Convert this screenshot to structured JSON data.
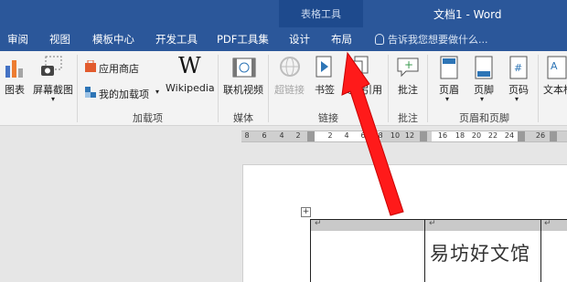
{
  "window": {
    "context_group": "表格工具",
    "doc_title": "文档1 - Word"
  },
  "tabs": [
    "审阅",
    "视图",
    "模板中心",
    "开发工具",
    "PDF工具集",
    "设计",
    "布局"
  ],
  "tell_me": "告诉我您想要做什么...",
  "ribbon": {
    "chart": "图表",
    "screenshot": "屏幕截图",
    "app_store": "应用商店",
    "my_addins": "我的加载项",
    "wikipedia_logo": "W",
    "wikipedia": "Wikipedia",
    "online_video": "联机视频",
    "link": "超链接",
    "bookmark": "书签",
    "cross_ref": "交叉引用",
    "comment": "批注",
    "header": "页眉",
    "footer": "页脚",
    "page_number": "页码",
    "textbox": "文本框",
    "groups": {
      "addins": "加载项",
      "media": "媒体",
      "links": "链接",
      "comments": "批注",
      "header_footer": "页眉和页脚"
    }
  },
  "ruler": {
    "left_ticks": [
      "8",
      "6",
      "4",
      "2"
    ],
    "mid_ticks": [
      "2",
      "4",
      "6",
      "8"
    ],
    "right_ticks": [
      "10",
      "12",
      "16",
      "18",
      "20",
      "22",
      "24",
      "26"
    ]
  },
  "table": {
    "handle": "+",
    "cell_mark": "↵"
  },
  "watermark": "易坊好文馆",
  "colors": {
    "title_bar": "#2b579a",
    "contextual_tab": "#1e4a8d",
    "arrow": "#ff1a1a"
  }
}
